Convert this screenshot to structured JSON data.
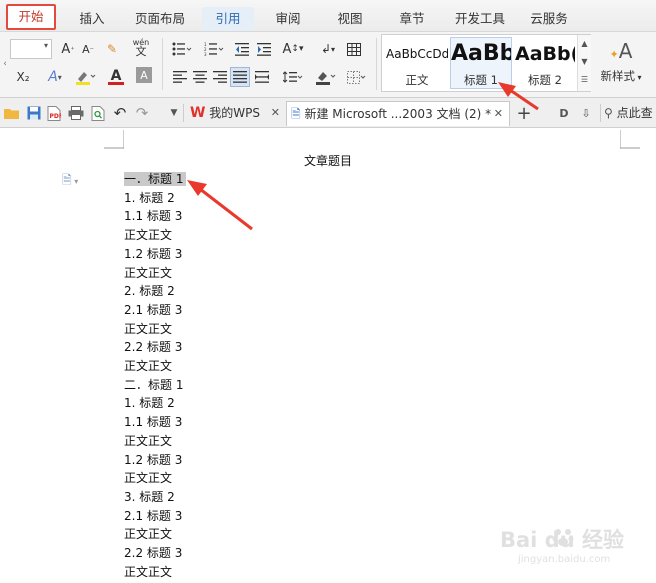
{
  "menu": {
    "tabs": [
      "开始",
      "插入",
      "页面布局",
      "引用",
      "审阅",
      "视图",
      "章节",
      "开发工具",
      "云服务"
    ]
  },
  "ribbon": {
    "font_size_value": "",
    "styles": [
      {
        "preview": "AaBbCcDd",
        "name": "正文"
      },
      {
        "preview": "AaBb",
        "name": "标题 1"
      },
      {
        "preview": "AaBb(",
        "name": "标题 2"
      }
    ],
    "new_style_label": "新样式",
    "subscript_label": "X₂",
    "font_letter": "A",
    "wen_label": "wén"
  },
  "toolbar2": {
    "tabs": [
      {
        "label": "我的WPS"
      },
      {
        "label": "新建 Microsoft ...2003 文档 (2) *"
      }
    ],
    "search_label": "点此查"
  },
  "document": {
    "title": "文章题目",
    "lines": [
      "一．标题 1",
      "1. 标题 2",
      "1.1 标题 3",
      "正文正文",
      "1.2 标题 3",
      "正文正文",
      "2. 标题 2",
      "2.1 标题 3",
      "正文正文",
      "2.2 标题 3",
      "正文正文",
      "二．标题 1",
      "1. 标题 2",
      "1.1 标题 3",
      "正文正文",
      "1.2 标题 3",
      "正文正文",
      "3. 标题 2",
      "2.1 标题 3",
      "正文正文",
      "2.2 标题 3",
      "正文正文"
    ]
  },
  "watermark": {
    "text": "Bai du 经验",
    "sub": "jingyan.baidu.com"
  },
  "colors": {
    "accent_red": "#e34a3c",
    "arrow_red": "#e8392c",
    "font_red": "#d22020",
    "highlight": "#c9c9c9"
  }
}
